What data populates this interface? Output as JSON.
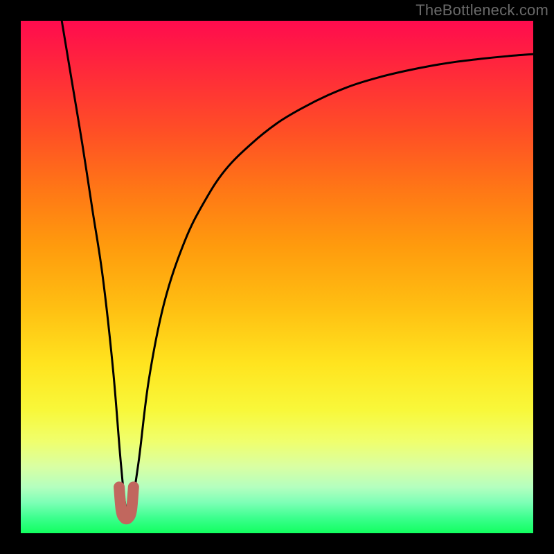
{
  "watermark": "TheBottleneck.com",
  "chart_data": {
    "type": "line",
    "title": "",
    "xlabel": "",
    "ylabel": "",
    "xlim": [
      0,
      100
    ],
    "ylim": [
      0,
      100
    ],
    "series": [
      {
        "name": "curve",
        "x": [
          8,
          10,
          12,
          14,
          16,
          18,
          19.5,
          20.5,
          21.5,
          23,
          25,
          28,
          32,
          36,
          40,
          45,
          50,
          55,
          60,
          65,
          70,
          75,
          80,
          85,
          90,
          95,
          100
        ],
        "values": [
          100,
          88,
          76,
          63,
          50,
          32,
          14,
          5,
          5,
          14,
          30,
          45,
          57,
          65,
          71,
          76,
          80,
          83,
          85.5,
          87.5,
          89,
          90.2,
          91.2,
          92,
          92.6,
          93.1,
          93.5
        ]
      },
      {
        "name": "valley-highlight",
        "x": [
          19.2,
          19.6,
          20.2,
          21.0,
          21.6,
          22.0
        ],
        "values": [
          9,
          4.5,
          3,
          3,
          4.5,
          9
        ]
      }
    ],
    "colors": {
      "curve": "#000000",
      "valley": "#c1675e"
    }
  }
}
